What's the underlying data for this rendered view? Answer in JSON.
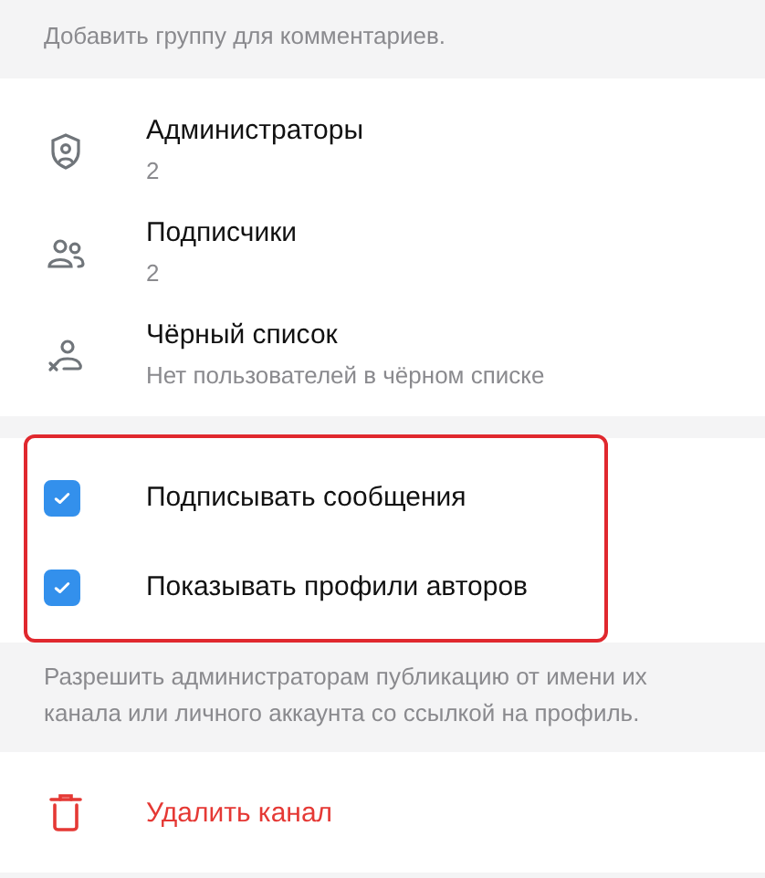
{
  "top_hint": "Добавить группу для комментариев.",
  "menu_items": [
    {
      "kind": "admins",
      "title": "Администраторы",
      "subtitle": "2"
    },
    {
      "kind": "subscribers",
      "title": "Подписчики",
      "subtitle": "2"
    },
    {
      "kind": "blacklist",
      "title": "Чёрный список",
      "subtitle": "Нет пользователей в чёрном списке"
    }
  ],
  "options": {
    "highlighted": true,
    "items": [
      {
        "label": "Подписывать сообщения",
        "checked": true
      },
      {
        "label": "Показывать профили авторов",
        "checked": true
      }
    ]
  },
  "options_hint": "Разрешить администраторам публикацию от имени их канала или личного аккаунта со ссылкой на профиль.",
  "delete_button": {
    "label": "Удалить канал"
  }
}
